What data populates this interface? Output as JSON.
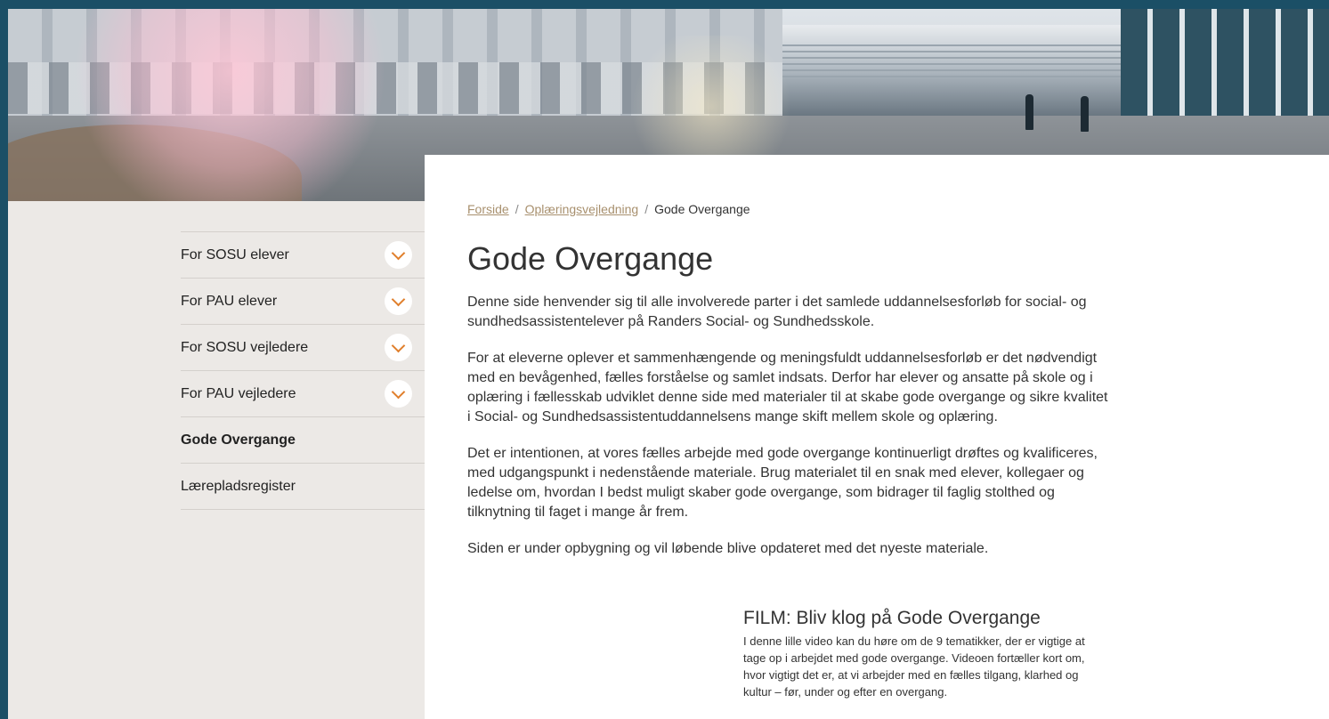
{
  "sidebar": {
    "items": [
      {
        "label": "For SOSU elever",
        "expandable": true
      },
      {
        "label": "For PAU elever",
        "expandable": true
      },
      {
        "label": "For SOSU vejledere",
        "expandable": true
      },
      {
        "label": "For PAU vejledere",
        "expandable": true
      },
      {
        "label": "Gode Overgange",
        "active": true
      },
      {
        "label": "Lærepladsregister"
      }
    ]
  },
  "breadcrumb": {
    "home": "Forside",
    "parent": "Oplæringsvejledning",
    "current": "Gode Overgange",
    "separator": "/"
  },
  "main": {
    "title": "Gode Overgange",
    "paragraphs": [
      "Denne side henvender sig til alle involverede parter i det samlede uddannelsesforløb for social- og sundhedsassistentelever på Randers Social- og Sundhedsskole.",
      "For at eleverne oplever et sammenhængende og meningsfuldt uddannelsesforløb er det nødvendigt med en bevågenhed, fælles forståelse og samlet indsats. Derfor har elever og ansatte på skole og i oplæring i fællesskab udviklet denne side med materialer til at skabe gode overgange og sikre kvalitet i Social- og Sundhedsassistentuddannelsens mange skift mellem skole og oplæring.",
      "Det er intentionen, at vores fælles arbejde med gode overgange kontinuerligt drøftes og kvalificeres, med udgangspunkt i nedenstående materiale. Brug materialet til en snak med elever, kollegaer og ledelse om, hvordan I bedst muligt skaber gode overgange, som bidrager til faglig stolthed og tilknytning til faget i mange år frem.",
      "Siden er under opbygning og vil løbende blive opdateret med det nyeste materiale."
    ],
    "film": {
      "title": "FILM: Bliv klog på Gode Overgange",
      "description": "I denne lille video kan du høre om de 9 tematikker, der er vigtige at tage op i arbejdet med gode overgange. Videoen fortæller kort om, hvor vigtigt det er, at vi arbejder med en fælles tilgang, klarhed og kultur – før, under og efter en overgang."
    }
  },
  "colors": {
    "outer_background": "#1b4f66",
    "sidebar_background": "#ece9e6",
    "accent_orange": "#e07f2c",
    "link_tan": "#a8906e"
  }
}
